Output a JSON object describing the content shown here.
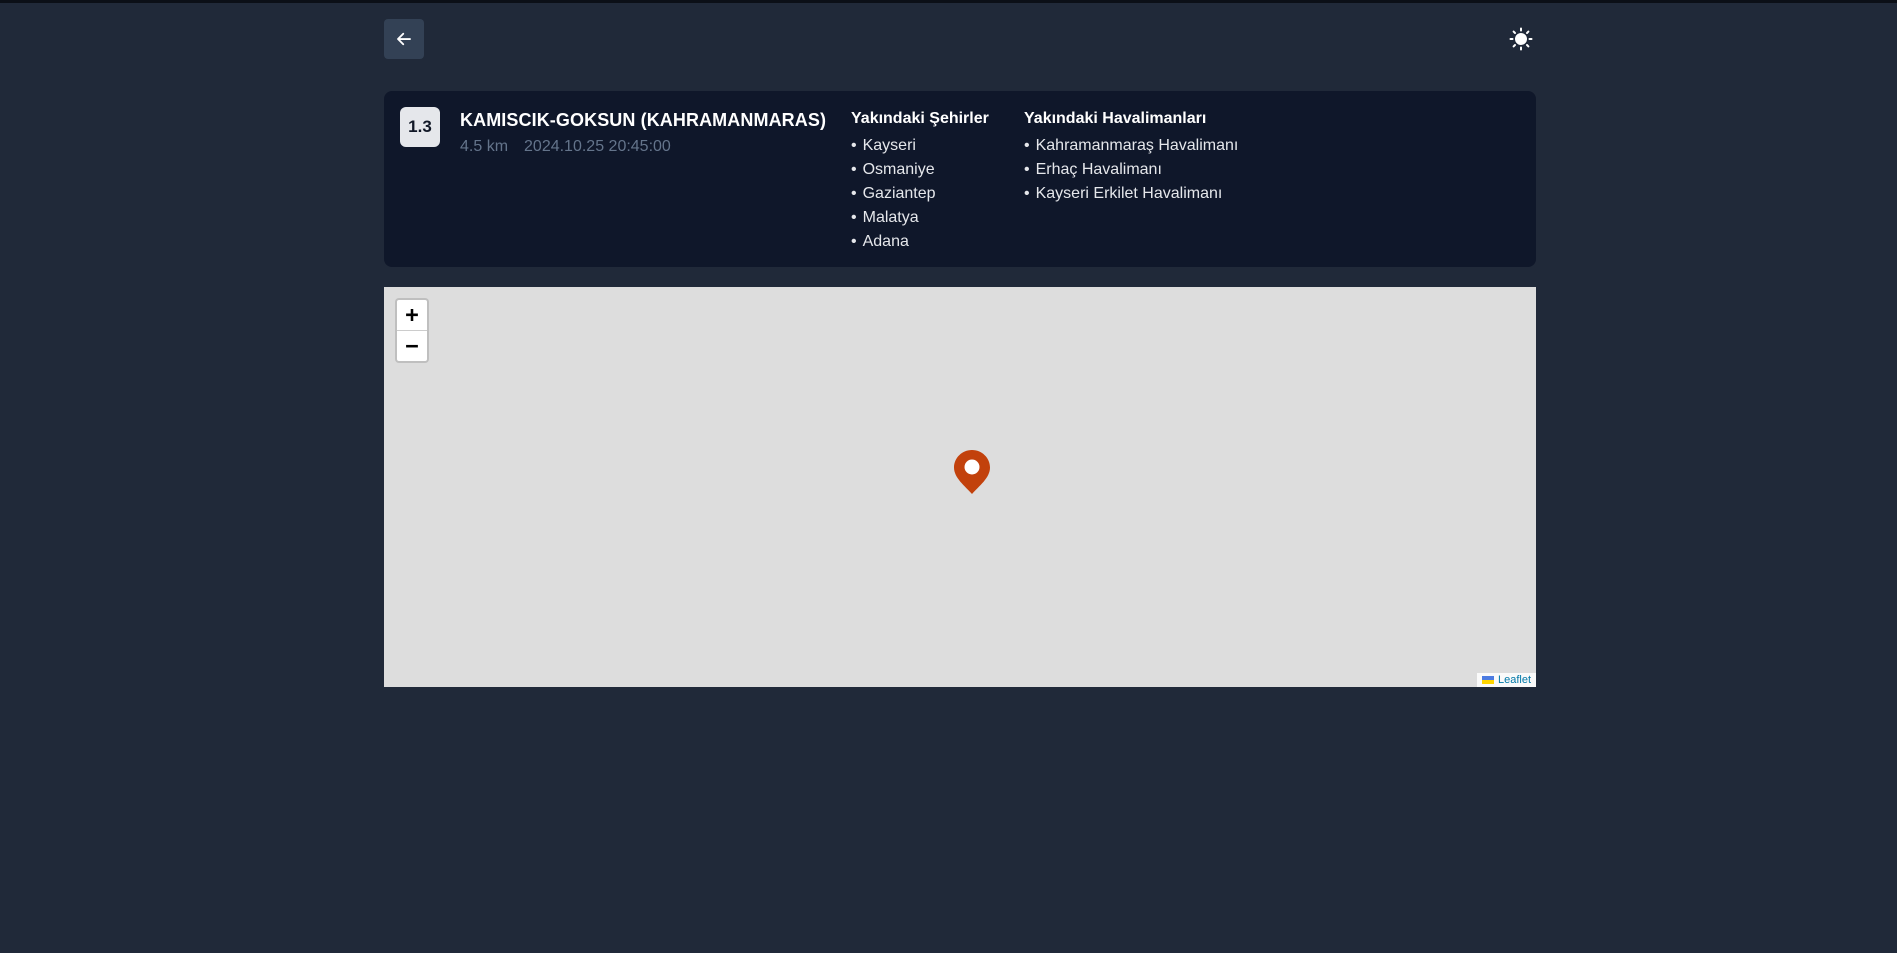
{
  "header": {
    "back_icon": "arrow-left-icon",
    "theme_icon": "sun-icon"
  },
  "earthquake": {
    "magnitude": "1.3",
    "location": "KAMISCIK-GOKSUN (KAHRAMANMARAS)",
    "depth": "4.5 km",
    "datetime": "2024.10.25 20:45:00"
  },
  "nearby_cities": {
    "heading": "Yakındaki Şehirler",
    "items": [
      "Kayseri",
      "Osmaniye",
      "Gaziantep",
      "Malatya",
      "Adana"
    ]
  },
  "nearby_airports": {
    "heading": "Yakındaki Havalimanları",
    "items": [
      "Kahramanmaraş Havalimanı",
      "Erhaç Havalimanı",
      "Kayseri Erkilet Havalimanı"
    ]
  },
  "map": {
    "zoom_in_label": "+",
    "zoom_out_label": "−",
    "attribution": "Leaflet",
    "marker_color": "#c2410c"
  },
  "colors": {
    "background": "#202939",
    "card": "#0f172a",
    "button": "#334155"
  }
}
